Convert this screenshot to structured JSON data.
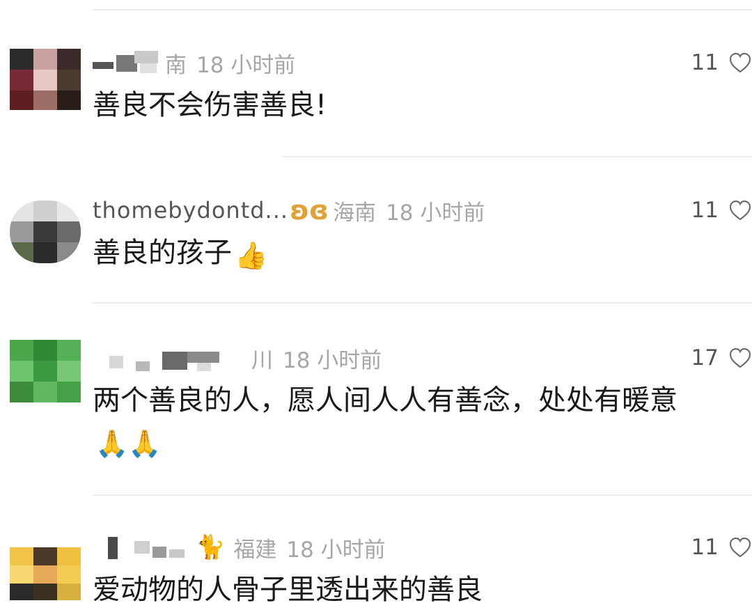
{
  "comments": [
    {
      "username_visible": "",
      "location": "海南",
      "time": "18 小时前",
      "content": "善良不会伤害善良!",
      "emoji": "",
      "likes": "11",
      "username_partial": "",
      "location_prefix": "南"
    },
    {
      "username_visible": "thomebydontd...",
      "location": "海南",
      "time": "18 小时前",
      "content": "善良的孩子",
      "emoji": "👍",
      "likes": "11",
      "badge_icon": "butterfly-badge"
    },
    {
      "username_visible": "",
      "location": "川",
      "time": "18 小时前",
      "content": "两个善良的人，愿人间人人有善念，处处有暖意",
      "emoji": "🙏🙏",
      "likes": "17"
    },
    {
      "username_visible": "",
      "location": "福建",
      "time": "18 小时前",
      "content": "爱动物的人骨子里透出来的善良",
      "emoji": "",
      "likes": "11",
      "badge_icon": "cat-badge"
    }
  ],
  "icons": {
    "heart": "heart-outline-icon"
  },
  "colors": {
    "text_primary": "#1a1a1a",
    "text_meta": "#a6a6a6",
    "like_count": "#555555",
    "divider": "#ececec",
    "badge_gold": "#e0a236"
  }
}
